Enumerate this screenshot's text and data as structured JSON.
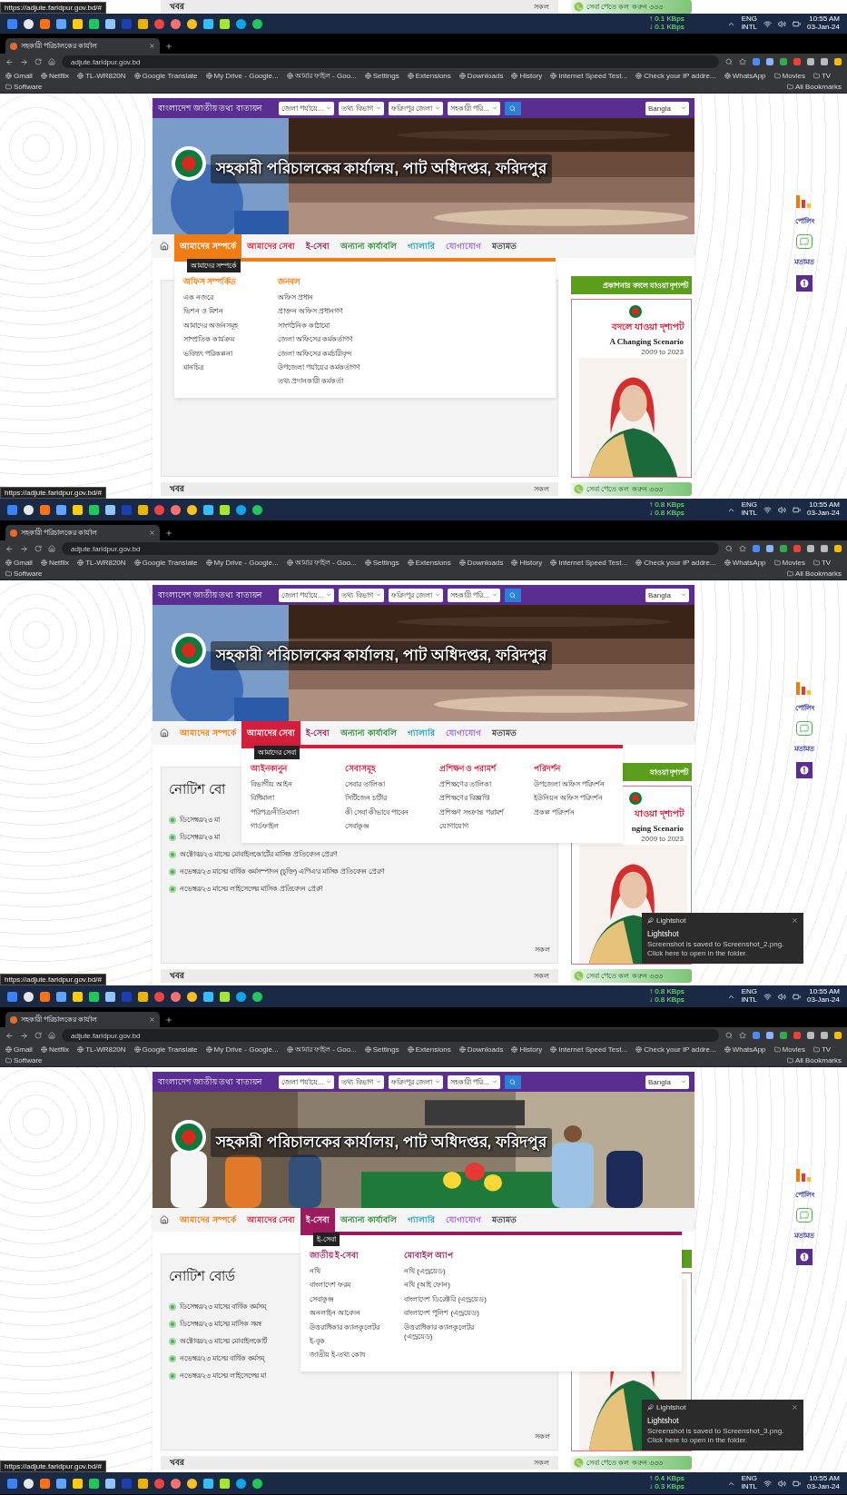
{
  "top_strip": {
    "news": {
      "title": "খবর",
      "more": "সকল"
    },
    "hotline": "সেবা পেতে কল করুন ৩৩৩",
    "status_url": "https://adjute.faridpur.gov.bd/#",
    "taskbar": {
      "upload": "↑ 0.1 KBps",
      "download": "↓ 0.1 KBps",
      "lang": "ENG",
      "layout": "INTL",
      "time": "10:55 AM",
      "date": "03-Jan-24"
    }
  },
  "screenshots": [
    {
      "tab_title": "সহকারী পরিচালকের কার্যাল",
      "address": "adjute.faridpur.gov.bd",
      "bookmarks": [
        {
          "label": "Gmail",
          "kind": "site"
        },
        {
          "label": "Netflix",
          "kind": "site"
        },
        {
          "label": "TL-WR820N",
          "kind": "site"
        },
        {
          "label": "Google Translate",
          "kind": "site"
        },
        {
          "label": "My Drive - Google...",
          "kind": "site"
        },
        {
          "label": "আমার ফাইল - Goo...",
          "kind": "site"
        },
        {
          "label": "Settings",
          "kind": "site"
        },
        {
          "label": "Extensions",
          "kind": "site"
        },
        {
          "label": "Downloads",
          "kind": "site"
        },
        {
          "label": "History",
          "kind": "site"
        },
        {
          "label": "Internet Speed Test...",
          "kind": "site"
        },
        {
          "label": "Check your IP addre...",
          "kind": "site"
        },
        {
          "label": "WhatsApp",
          "kind": "site"
        },
        {
          "label": "Movies",
          "kind": "folder"
        },
        {
          "label": "TV",
          "kind": "folder"
        },
        {
          "label": "Software",
          "kind": "folder"
        }
      ],
      "all_bookmarks": "All Bookmarks",
      "site": {
        "portal": "বাংলাদেশ জাতীয় তথ্য বাতায়ন",
        "selects": [
          "জেলা পর্যায়ে...",
          "তথ্য বিভাগ",
          "ফরিদপুর জেলা",
          "সহকারী পরি..."
        ],
        "language": "Bangla",
        "banner_title": "সহকারী পরিচালকের কার্যালয়, পাট অধিদপ্তর, ফরিদপুর",
        "nav": [
          {
            "label": "আমাদের সম্পর্কে",
            "color": "#f07d13",
            "selected": true
          },
          {
            "label": "আমাদের সেবা",
            "color": "#d21f3c",
            "selected": false
          },
          {
            "label": "ই-সেবা",
            "color": "#9c1a5e",
            "selected": false
          },
          {
            "label": "অন্যান্য কার্যাবলি",
            "color": "#2e8b3a",
            "selected": false
          },
          {
            "label": "গ্যালারি",
            "color": "#1aa3c8",
            "selected": false
          },
          {
            "label": "যোগাযোগ",
            "color": "#a26ad1",
            "selected": false
          },
          {
            "label": "মতামত",
            "color": "#333333",
            "selected": false
          }
        ],
        "menu": {
          "tooltip": "আমাদের সম্পর্কে",
          "columns": [
            {
              "heading": "অফিস সম্পর্কিত",
              "items": [
                "এক নজরে",
                "ভিশন ও মিশন",
                "আমাদের অর্জনসমূহ",
                "সাম্প্রতিক কার্যক্রম",
                "ভবিষ্যৎ পরিকল্পনা",
                "মানচিত্র"
              ]
            },
            {
              "heading": "জনবল",
              "items": [
                "অফিস প্রধান",
                "প্রাক্তন অফিস প্রধানগণ",
                "সাংগঠনিক কাঠামো",
                "জেলা অফিসের কর্মকর্তাগণ",
                "জেলা অফিসের কর্মচারীবৃন্দ",
                "উপজেলা পর্যায়ের কর্মকর্তাগণ",
                "তথ্য প্রদানকারী কর্মকর্তা"
              ]
            }
          ]
        },
        "sidebar": {
          "heading": "প্রকাশনার বদলে যাওয়া দৃশ্যপট",
          "cover": {
            "title": "বদলে যাওয়া দৃশ্যপট",
            "subtitle": "A Changing Scenario",
            "note": "2009 to 2023"
          },
          "hotline": "সেবা পেতে কল করুন ৩৩৩"
        },
        "news": {
          "title": "খবর",
          "more": "সকল"
        },
        "widgets": [
          "পোলিং",
          "মতামত"
        ]
      },
      "status_url": "https://adjute.faridpur.gov.bd/#",
      "taskbar": {
        "upload": "↑ 0.8 KBps",
        "download": "↓ 0.8 KBps",
        "lang": "ENG",
        "layout": "INTL",
        "time": "10:55 AM",
        "date": "03-Jan-24"
      }
    },
    {
      "tab_title": "সহকারী পরিচালকের কার্যাল",
      "address": "adjute.faridpur.gov.bd",
      "bookmarks": [
        {
          "label": "Gmail",
          "kind": "site"
        },
        {
          "label": "Netflix",
          "kind": "site"
        },
        {
          "label": "TL-WR820N",
          "kind": "site"
        },
        {
          "label": "Google Translate",
          "kind": "site"
        },
        {
          "label": "My Drive - Google...",
          "kind": "site"
        },
        {
          "label": "আমার ফাইল - Goo...",
          "kind": "site"
        },
        {
          "label": "Settings",
          "kind": "site"
        },
        {
          "label": "Extensions",
          "kind": "site"
        },
        {
          "label": "Downloads",
          "kind": "site"
        },
        {
          "label": "History",
          "kind": "site"
        },
        {
          "label": "Internet Speed Test...",
          "kind": "site"
        },
        {
          "label": "Check your IP addre...",
          "kind": "site"
        },
        {
          "label": "WhatsApp",
          "kind": "site"
        },
        {
          "label": "Movies",
          "kind": "folder"
        },
        {
          "label": "TV",
          "kind": "folder"
        },
        {
          "label": "Software",
          "kind": "folder"
        }
      ],
      "all_bookmarks": "All Bookmarks",
      "site": {
        "portal": "বাংলাদেশ জাতীয় তথ্য বাতায়ন",
        "selects": [
          "জেলা পর্যায়ে...",
          "তথ্য বিভাগ",
          "ফরিদপুর জেলা",
          "সহকারী পরি..."
        ],
        "language": "Bangla",
        "banner_title": "সহকারী পরিচালকের কার্যালয়, পাট অধিদপ্তর, ফরিদপুর",
        "nav": [
          {
            "label": "আমাদের সম্পর্কে",
            "color": "#f07d13",
            "selected": false
          },
          {
            "label": "আমাদের সেবা",
            "color": "#d21f3c",
            "selected": true
          },
          {
            "label": "ই-সেবা",
            "color": "#9c1a5e",
            "selected": false
          },
          {
            "label": "অন্যান্য কার্যাবলি",
            "color": "#2e8b3a",
            "selected": false
          },
          {
            "label": "গ্যালারি",
            "color": "#1aa3c8",
            "selected": false
          },
          {
            "label": "যোগাযোগ",
            "color": "#a26ad1",
            "selected": false
          },
          {
            "label": "মতামত",
            "color": "#333333",
            "selected": false
          }
        ],
        "menu": {
          "tooltip": "আমাদের সেবা",
          "columns": [
            {
              "heading": "আইনকানুন",
              "items": [
                "বিভাগীয় আইন",
                "বিধিমালা",
                "পরিপত্র/নীতিমালা",
                "গার্ডফাইল"
              ]
            },
            {
              "heading": "সেবাসমূহ",
              "items": [
                "সেবার তালিকা",
                "সিটিজেন চার্টার",
                "কী সেবা কীভাবে পাবেন",
                "সেবাকুঞ্জ"
              ]
            },
            {
              "heading": "প্রশিক্ষণ ও পরামর্শ",
              "items": [
                "প্রশিক্ষণের তালিকা",
                "প্রশিক্ষণের বিজ্ঞপ্তি",
                "প্রশিক্ষণ সংক্রান্ত পরামর্শ",
                "যোগাযোগ"
              ]
            },
            {
              "heading": "পরিদর্শন",
              "items": [
                "উপজেলা অফিস পরিদর্শন",
                "ইউনিয়ন অফিস পরিদর্শন",
                "প্রকল্প পরিদর্শন"
              ]
            }
          ]
        },
        "notice_board": {
          "title": "নোটিশ বো",
          "items": [
            "ডিসেম্বর/২৩ মা",
            "ডিসেম্বর/২৩ মা",
            "অক্টোবর/২৩ মাসের মোবাইলকোর্টের মাসিক প্রতিবেদন প্রেরণ",
            "নভেম্বর/২৩ মাসের বার্ষিক কর্মসম্পাদন (চুক্তি) এপিএ’র মাসিক প্রতিবেদন প্রেরণ",
            "নভেম্বর/২৩ মাসের লাইসেন্সের মাসিক প্রতিবেদন প্রেরণ"
          ],
          "more": "সকল"
        },
        "sidebar": {
          "heading": "যাওয়া দৃশ্যপট",
          "cover": {
            "title": "যাওয়া দৃশ্যপট",
            "subtitle": "nging Scenario",
            "note": "2009 to 2023"
          },
          "hotline": "সেবা পেতে কল করুন ৩৩৩"
        },
        "news": {
          "title": "খবর",
          "more": "সকল"
        },
        "widgets": [
          "পোলিং",
          "মতামত"
        ]
      },
      "status_url": "https://adjute.faridpur.gov.bd/#",
      "toast": {
        "app": "Lightshot",
        "title": "Lightshot",
        "message": "Screenshot is saved to Screenshot_2.png. Click here to open in the folder."
      },
      "taskbar": {
        "upload": "↑ 0.8 KBps",
        "download": "↓ 0.8 KBps",
        "lang": "ENG",
        "layout": "INTL",
        "time": "10:55 AM",
        "date": "03-Jan-24"
      }
    },
    {
      "tab_title": "সহকারী পরিচালকের কার্যাল",
      "address": "adjute.faridpur.gov.bd",
      "bookmarks": [
        {
          "label": "Gmail",
          "kind": "site"
        },
        {
          "label": "Netflix",
          "kind": "site"
        },
        {
          "label": "TL-WR820N",
          "kind": "site"
        },
        {
          "label": "Google Translate",
          "kind": "site"
        },
        {
          "label": "My Drive - Google...",
          "kind": "site"
        },
        {
          "label": "আমার ফাইল - Goo...",
          "kind": "site"
        },
        {
          "label": "Settings",
          "kind": "site"
        },
        {
          "label": "Extensions",
          "kind": "site"
        },
        {
          "label": "Downloads",
          "kind": "site"
        },
        {
          "label": "History",
          "kind": "site"
        },
        {
          "label": "Internet Speed Test...",
          "kind": "site"
        },
        {
          "label": "Check your IP addre...",
          "kind": "site"
        },
        {
          "label": "WhatsApp",
          "kind": "site"
        },
        {
          "label": "Movies",
          "kind": "folder"
        },
        {
          "label": "TV",
          "kind": "folder"
        },
        {
          "label": "Software",
          "kind": "folder"
        }
      ],
      "all_bookmarks": "All Bookmarks",
      "site": {
        "portal": "বাংলাদেশ জাতীয় তথ্য বাতায়ন",
        "selects": [
          "জেলা পর্যায়ে...",
          "তথ্য বিভাগ",
          "ফরিদপুর জেলা",
          "সহকারী পরি..."
        ],
        "language": "Bangla",
        "banner_title": "সহকারী পরিচালকের কার্যালয়, পাট অধিদপ্তর, ফরিদপুর",
        "nav": [
          {
            "label": "আমাদের সম্পর্কে",
            "color": "#f07d13",
            "selected": false
          },
          {
            "label": "আমাদের সেবা",
            "color": "#d21f3c",
            "selected": false
          },
          {
            "label": "ই-সেবা",
            "color": "#9c1a5e",
            "selected": true
          },
          {
            "label": "অন্যান্য কার্যাবলি",
            "color": "#2e8b3a",
            "selected": false
          },
          {
            "label": "গ্যালারি",
            "color": "#1aa3c8",
            "selected": false
          },
          {
            "label": "যোগাযোগ",
            "color": "#a26ad1",
            "selected": false
          },
          {
            "label": "মতামত",
            "color": "#333333",
            "selected": false
          }
        ],
        "menu": {
          "tooltip": "ই-সেবা",
          "columns": [
            {
              "heading": "জাতীয় ই-সেবা",
              "items": [
                "নথি",
                "বাংলাদেশ ফরম",
                "সেবাকুঞ্জ",
                "অনলাইন আবেদন",
                "উত্তরাধিকার ক্যালকুলেটর",
                "ই-বুক",
                "জাতীয় ই-তথ্য কোষ"
              ]
            },
            {
              "heading": "মোবাইল অ্যাপ",
              "items": [
                "নথি (এন্ড্রয়েড)",
                "নথি (আই ফোন)",
                "বাংলাদেশ ডিরেক্টরি (এন্ড্রয়েড)",
                "বাংলাদেশ পুলিশ (এন্ড্রয়েড)",
                "উত্তরাধিকার ক্যালকুলেটর (এন্ড্রয়েড)"
              ]
            }
          ]
        },
        "notice_board": {
          "title": "নোটিশ বোর্ড",
          "items": [
            "ডিসেম্বর/২৩ মাসের বার্ষিক কর্মসম্",
            "ডিসেম্বর/২৩ মাসের মাসিক সমন্ব",
            "অক্টোবর/২৩ মাসের মোবাইলকোর্ট",
            "নভেম্বর/২৩ মাসের বার্ষিক কর্মসম্",
            "নভেম্বর/২৩ মাসের লাইসেন্সের মা"
          ],
          "more": "সকল"
        },
        "sidebar": {
          "hotline": "সেবা পেতে কল করুন ৩৩৩"
        },
        "news": {
          "title": "খবর",
          "more": "সকল"
        },
        "widgets": [
          "পোলিং",
          "মতামত"
        ]
      },
      "status_url": "https://adjute.faridpur.gov.bd/#",
      "toast": {
        "app": "Lightshot",
        "title": "Lightshot",
        "message": "Screenshot is saved to Screenshot_3.png. Click here to open in the folder."
      },
      "taskbar": {
        "upload": "↑ 0.4 KBps",
        "download": "↓ 0.3 KBps",
        "lang": "ENG",
        "layout": "INTL",
        "time": "10:55 AM",
        "date": "03-Jan-24"
      }
    }
  ]
}
